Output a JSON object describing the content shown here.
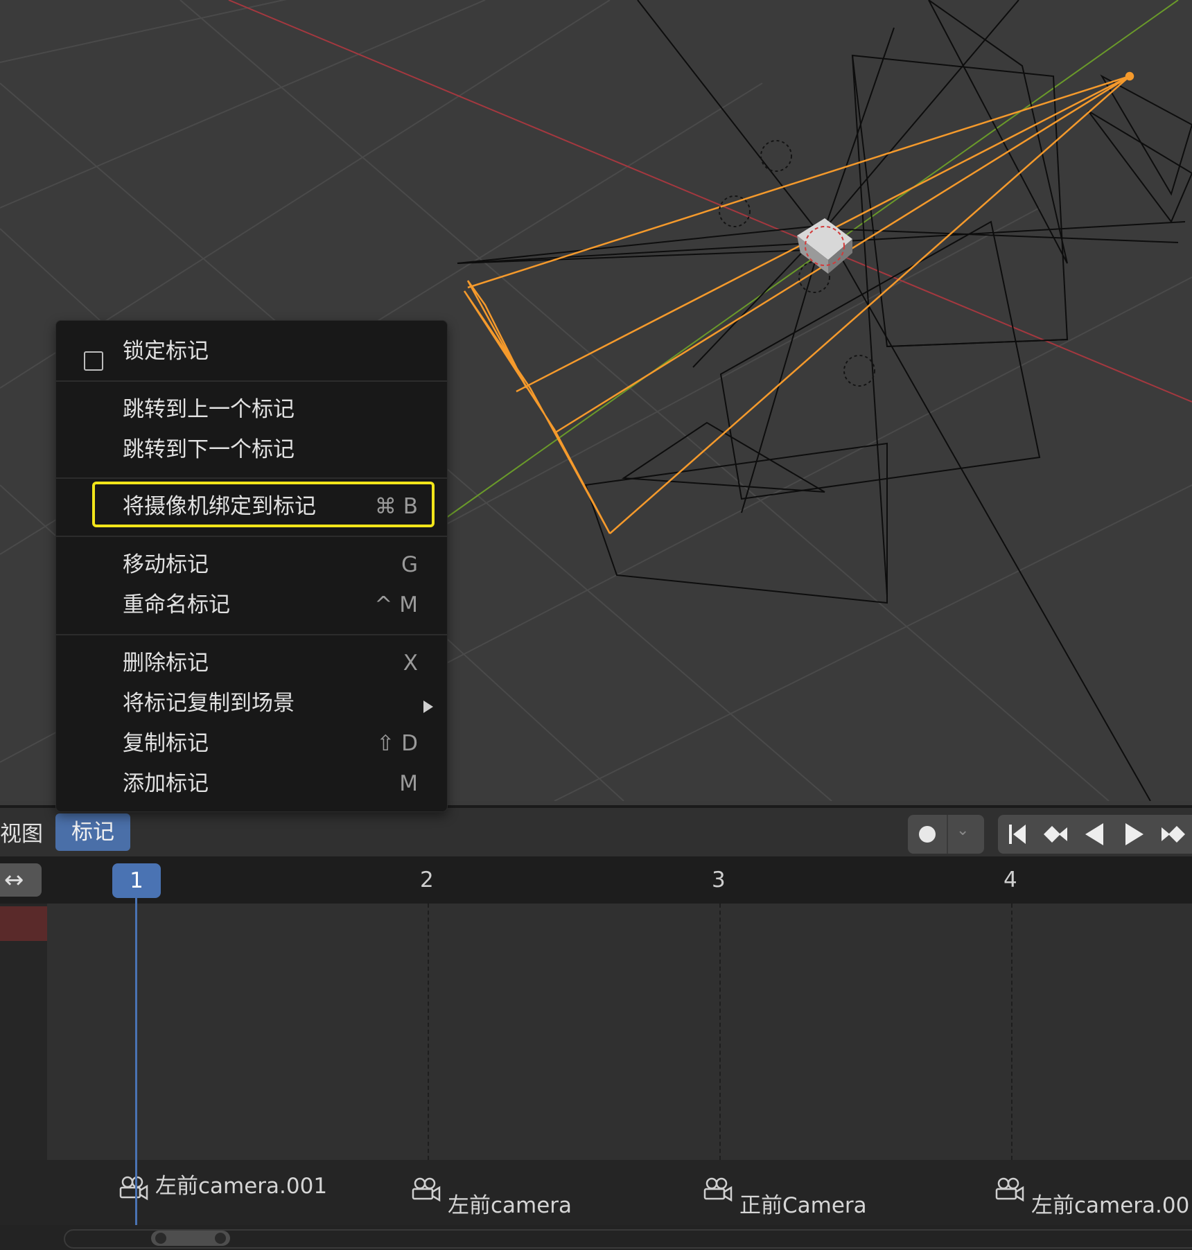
{
  "menu": {
    "items": [
      {
        "label": "锁定标记",
        "shortcut": ""
      },
      {
        "label": "跳转到上一个标记",
        "shortcut": ""
      },
      {
        "label": "跳转到下一个标记",
        "shortcut": ""
      },
      {
        "label": "将摄像机绑定到标记",
        "shortcut": "⌘ B"
      },
      {
        "label": "移动标记",
        "shortcut": "G"
      },
      {
        "label": "重命名标记",
        "shortcut": "^ M"
      },
      {
        "label": "删除标记",
        "shortcut": "X"
      },
      {
        "label": "将标记复制到场景",
        "shortcut": ""
      },
      {
        "label": "复制标记",
        "shortcut": "⇧ D"
      },
      {
        "label": "添加标记",
        "shortcut": "M"
      }
    ]
  },
  "timeline": {
    "menus": {
      "view": "视图",
      "marker": "标记"
    },
    "current_frame": "1",
    "frames": [
      "2",
      "3",
      "4"
    ],
    "markers": [
      {
        "name": "左前camera.001"
      },
      {
        "name": "左前camera"
      },
      {
        "name": "正前Camera"
      },
      {
        "name": "左前camera.00"
      }
    ]
  },
  "icons": [
    "checkbox-icon",
    "submenu-arrow-icon",
    "record-icon",
    "chevron-down-icon",
    "jump-start-icon",
    "prev-keyframe-icon",
    "play-reverse-icon",
    "play-icon",
    "next-keyframe-icon",
    "swap-icon",
    "camera-marker-icon"
  ],
  "colors": {
    "highlight": "#f2e51a",
    "accent": "#4a73b3",
    "selected_camera": "#f59a2c"
  }
}
